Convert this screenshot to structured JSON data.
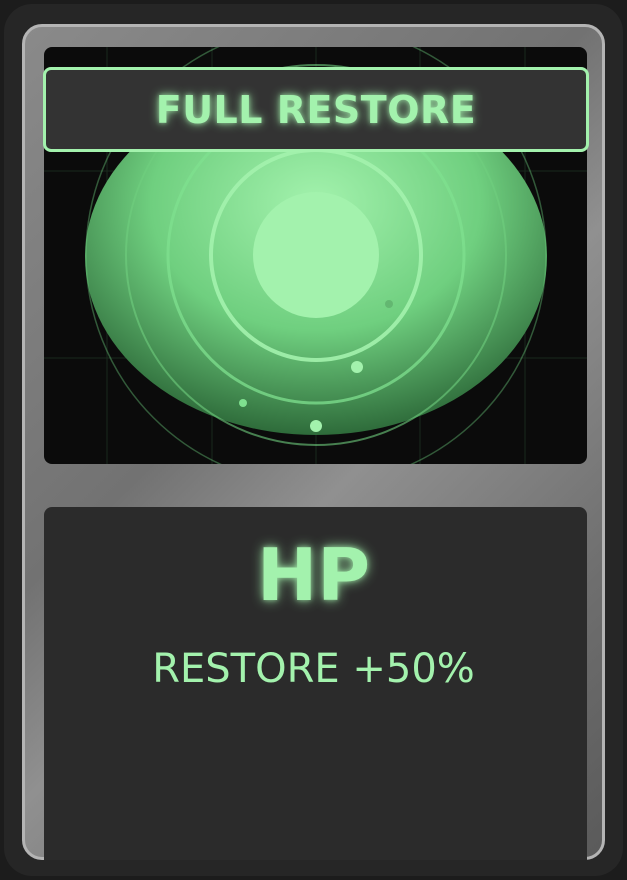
{
  "card": {
    "title": "FULL RESTORE",
    "stat": "HP",
    "effect": "RESTORE +50%"
  },
  "colors": {
    "accent": "#a3f2ad",
    "panel": "#2b2b2b",
    "banner": "#333333",
    "frame": "#8a8a8a",
    "art_background": "#0b0b0b"
  },
  "art": {
    "icon": "green-orb-icon"
  }
}
